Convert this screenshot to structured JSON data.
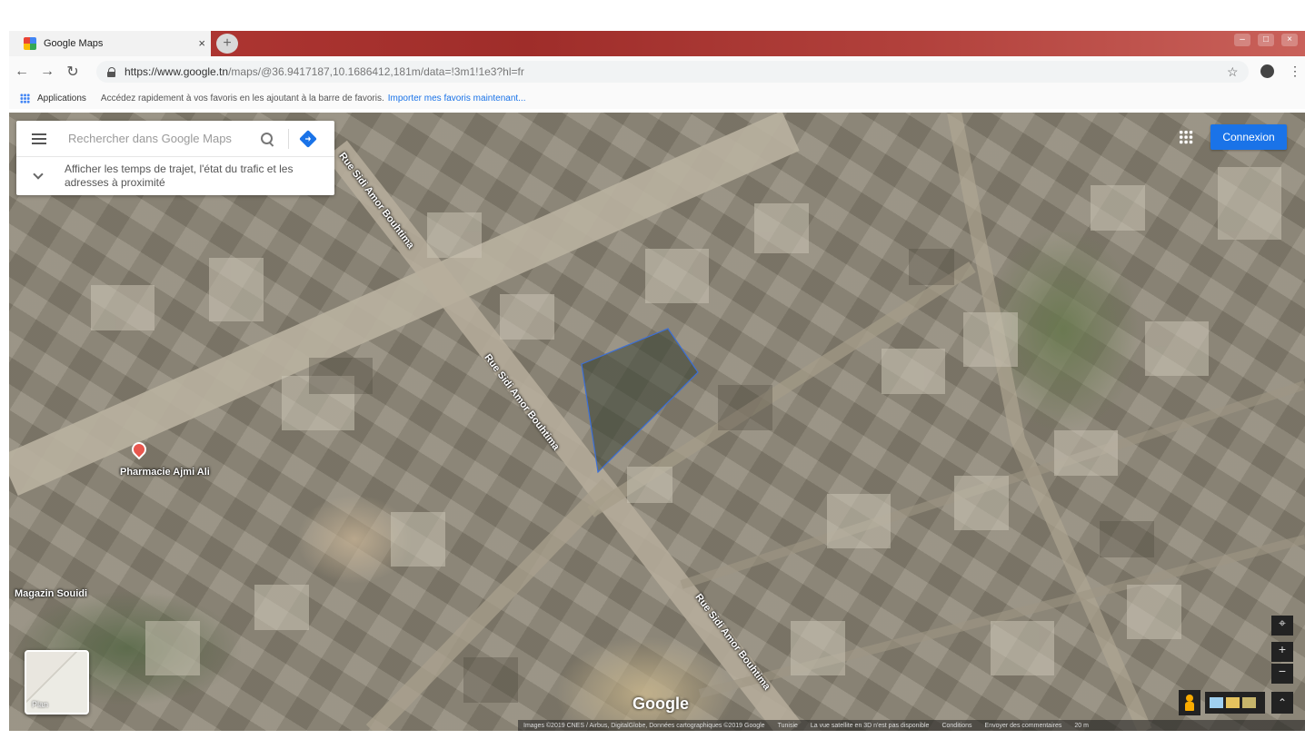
{
  "browser": {
    "tab_title": "Google Maps",
    "tab_close": "×",
    "new_tab": "+",
    "url_host": "https://www.google.tn",
    "url_path": "/maps/@36.9417187,10.1686412,181m/data=!3m1!1e3?hl=fr",
    "window_controls": [
      "–",
      "□",
      "×"
    ],
    "back": "←",
    "forward": "→",
    "reload": "↻",
    "star": "☆",
    "menu": "⋮"
  },
  "bookmarks": {
    "apps_label": "Applications",
    "message": "Accédez rapidement à vos favoris en les ajoutant à la barre de favoris.",
    "import_link": "Importer mes favoris maintenant..."
  },
  "search": {
    "placeholder": "Rechercher dans Google Maps",
    "traffic_text": "Afficher les temps de trajet, l'état du trafic et les adresses à proximité"
  },
  "header": {
    "signin_label": "Connexion"
  },
  "map": {
    "street_name": "Rue Sidi Amor Bouhtima",
    "poi_pharmacy": "Pharmacie Ajmi Ali",
    "poi_store": "Magazin Souidi",
    "layer_label": "Plan",
    "google_logo": "Google",
    "zoom_in": "+",
    "zoom_out": "−",
    "compass": "⌖",
    "expand": "⌃",
    "footer": {
      "attribution": "Images ©2019 CNES / Airbus, DigitalGlobe, Données cartographiques ©2019 Google",
      "country": "Tunisie",
      "imagery_notice": "La vue satellite en 3D n'est pas disponible",
      "terms": "Conditions",
      "feedback": "Envoyer des commentaires",
      "scale": "20 m"
    },
    "colors": {
      "parcel_outline": "#3b6fd8",
      "signin_bg": "#1a73e8",
      "pin": "#e8574e"
    }
  }
}
